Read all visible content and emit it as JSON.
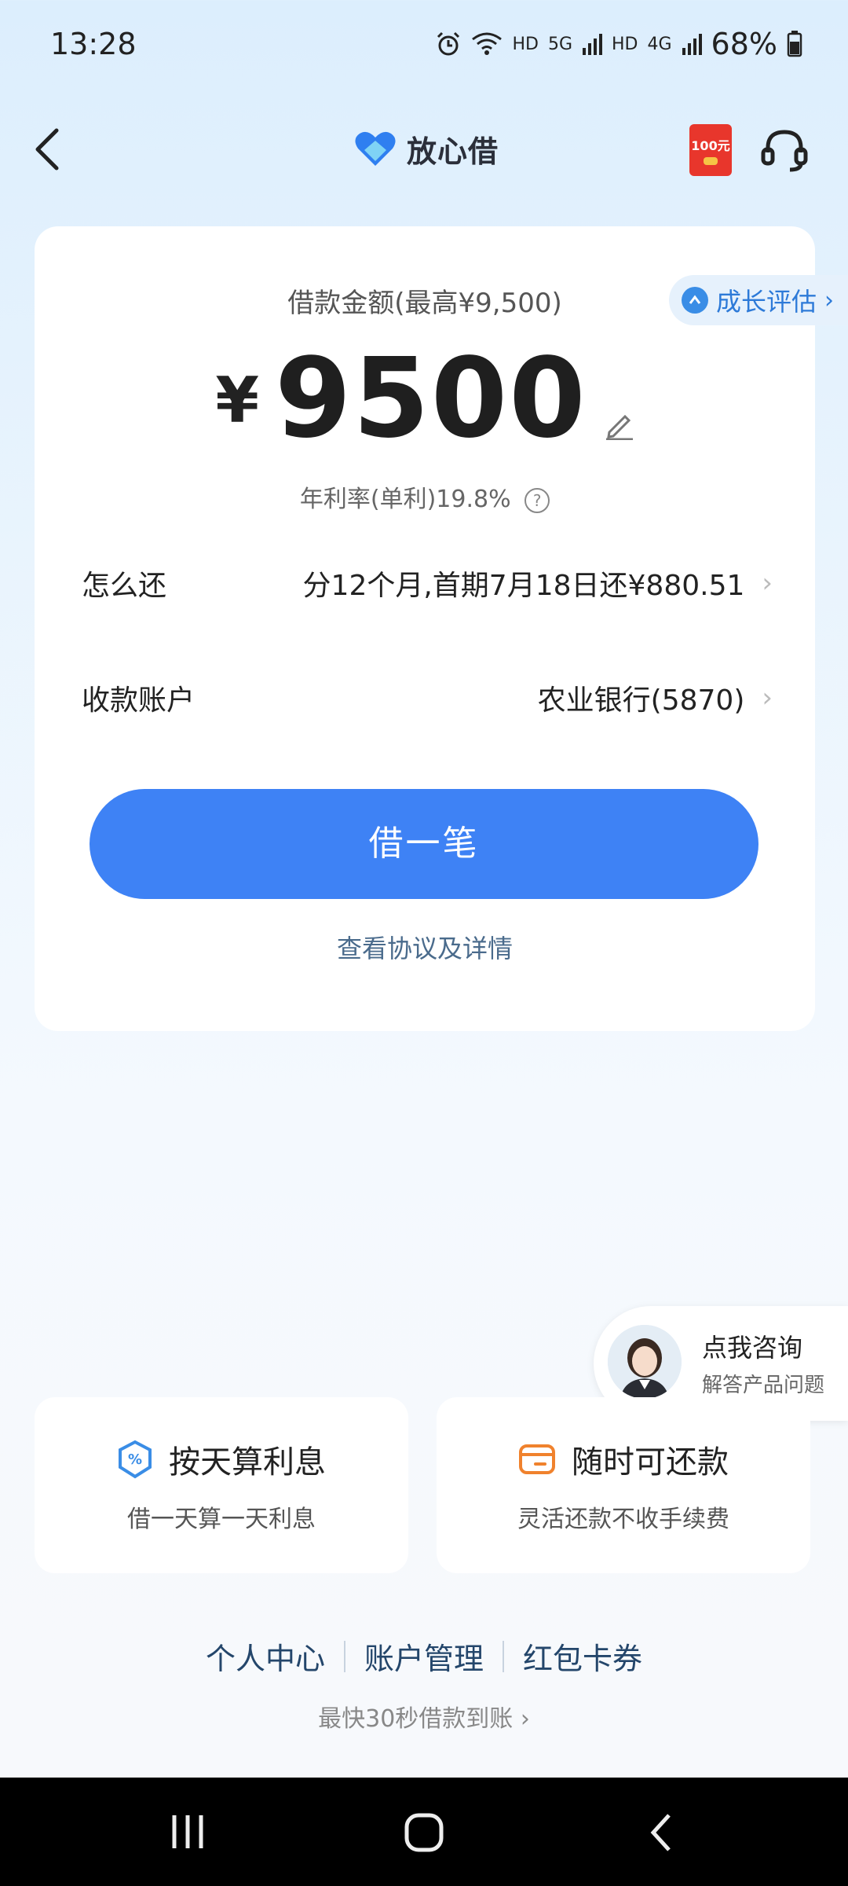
{
  "status_bar": {
    "time": "13:28",
    "hd1": "HD",
    "net1": "5G",
    "hd2": "HD",
    "net2": "4G",
    "battery": "68%"
  },
  "nav": {
    "brand_name": "放心借",
    "red_packet_amount": "100元"
  },
  "loan": {
    "amount_label": "借款金额(最高¥9,500)",
    "growth_tag": "成长评估",
    "currency": "¥",
    "amount": "9500",
    "rate_text": "年利率(单利)19.8%",
    "rate_help": "?",
    "repay_label": "怎么还",
    "repay_value": "分12个月,首期7月18日还¥880.51",
    "account_label": "收款账户",
    "account_value": "农业银行(5870)",
    "borrow_button": "借一笔",
    "agreement_link": "查看协议及详情"
  },
  "consult": {
    "title": "点我咨询",
    "subtitle": "解答产品问题"
  },
  "features": [
    {
      "icon": "percent-shield-icon",
      "title": "按天算利息",
      "desc": "借一天算一天利息"
    },
    {
      "icon": "wallet-icon",
      "title": "随时可还款",
      "desc": "灵活还款不收手续费"
    }
  ],
  "footer": {
    "links": [
      "个人中心",
      "账户管理",
      "红包卡券"
    ],
    "slogan": "最快30秒借款到账"
  },
  "colors": {
    "accent": "#3e82f5",
    "feature_icon_blue": "#3a8de6",
    "feature_icon_orange": "#f0822d"
  }
}
